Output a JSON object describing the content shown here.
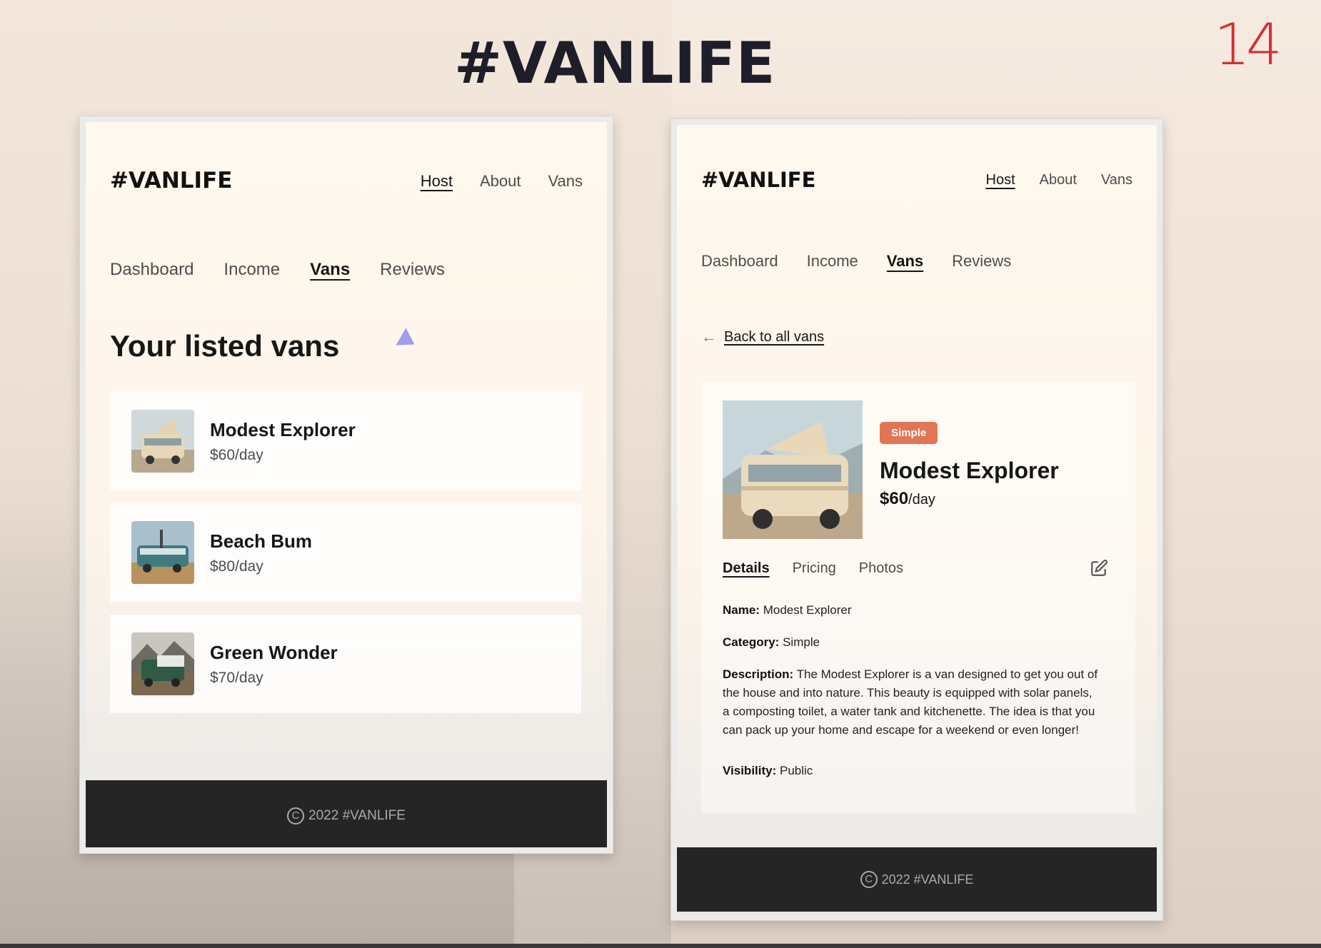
{
  "slide": {
    "title": "#VANLIFE",
    "page_number": "14"
  },
  "left_screen": {
    "logo": "#VANLIFE",
    "nav": [
      {
        "label": "Host",
        "active": true
      },
      {
        "label": "About",
        "active": false
      },
      {
        "label": "Vans",
        "active": false
      }
    ],
    "subnav": [
      {
        "label": "Dashboard",
        "active": false
      },
      {
        "label": "Income",
        "active": false
      },
      {
        "label": "Vans",
        "active": true
      },
      {
        "label": "Reviews",
        "active": false
      }
    ],
    "heading": "Your listed vans",
    "vans": [
      {
        "name": "Modest Explorer",
        "price": "$60/day",
        "image": "tan-camper-van"
      },
      {
        "name": "Beach Bum",
        "price": "$80/day",
        "image": "teal-van-desert"
      },
      {
        "name": "Green Wonder",
        "price": "$70/day",
        "image": "green-van-mountains"
      }
    ],
    "footer": {
      "icon": "copyright-icon",
      "text": "2022 #VANLIFE"
    }
  },
  "right_screen": {
    "logo": "#VANLIFE",
    "nav": [
      {
        "label": "Host",
        "active": true
      },
      {
        "label": "About",
        "active": false
      },
      {
        "label": "Vans",
        "active": false
      }
    ],
    "subnav": [
      {
        "label": "Dashboard",
        "active": false
      },
      {
        "label": "Income",
        "active": false
      },
      {
        "label": "Vans",
        "active": true
      },
      {
        "label": "Reviews",
        "active": false
      }
    ],
    "back_link": "Back to all vans",
    "van": {
      "badge": "Simple",
      "badge_color": "#e17654",
      "name": "Modest Explorer",
      "price": "$60",
      "price_unit": "/day"
    },
    "tabs": [
      {
        "label": "Details",
        "active": true
      },
      {
        "label": "Pricing",
        "active": false
      },
      {
        "label": "Photos",
        "active": false
      }
    ],
    "details": {
      "name_label": "Name:",
      "name_value": "Modest Explorer",
      "category_label": "Category:",
      "category_value": "Simple",
      "description_label": "Description:",
      "description_value": "The Modest Explorer is a van designed to get you out of the house and into nature. This beauty is equipped with solar panels, a composting toilet, a water tank and kitchenette. The idea is that you can pack up your home and escape for a weekend or even longer!",
      "visibility_label": "Visibility:",
      "visibility_value": "Public"
    },
    "footer": {
      "icon": "copyright-icon",
      "text": "2022 #VANLIFE"
    }
  }
}
